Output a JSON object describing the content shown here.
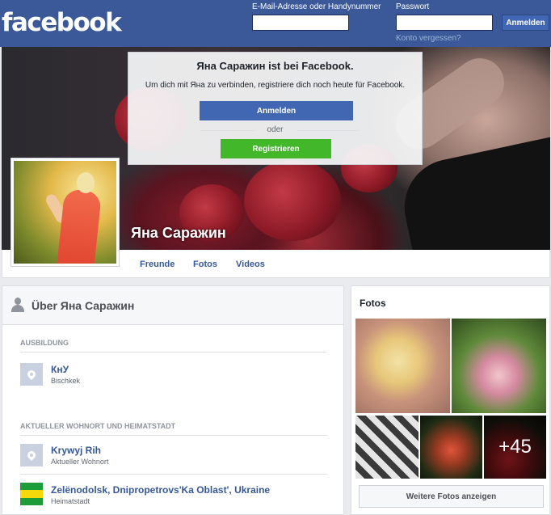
{
  "header": {
    "logo": "facebook",
    "email_label": "E-Mail-Adresse oder Handynummer",
    "password_label": "Passwort",
    "login_button": "Anmelden",
    "forgot_link": "Konto vergessen?"
  },
  "popup": {
    "title": "Яна Саражин ist bei Facebook.",
    "text": "Um dich mit Яна zu verbinden, registriere dich noch heute für Facebook.",
    "login_button": "Anmelden",
    "or": "oder",
    "register_button": "Registrieren"
  },
  "profile": {
    "name": "Яна Саражин"
  },
  "nav": {
    "items": [
      "Freunde",
      "Fotos",
      "Videos"
    ]
  },
  "about": {
    "title": "Über Яна Саражин",
    "education_heading": "AUSBILDUNG",
    "education": {
      "title": "КнУ",
      "subtitle": "Bischkek"
    },
    "residence_heading": "AKTUELLER WOHNORT UND HEIMATSTADT",
    "current_city": {
      "title": "Krywyj Rih",
      "subtitle": "Aktueller Wohnort"
    },
    "hometown": {
      "title": "Zelënodolsk, Dnipropetrovs'Ka Oblast', Ukraine",
      "subtitle": "Heimatstadt"
    }
  },
  "photos": {
    "title": "Fotos",
    "more_count": "+45",
    "more_button": "Weitere Fotos anzeigen"
  },
  "colors": {
    "brand_blue": "#3b5998",
    "button_blue": "#4267b2",
    "register_green": "#42b72a",
    "link_blue": "#365899"
  }
}
